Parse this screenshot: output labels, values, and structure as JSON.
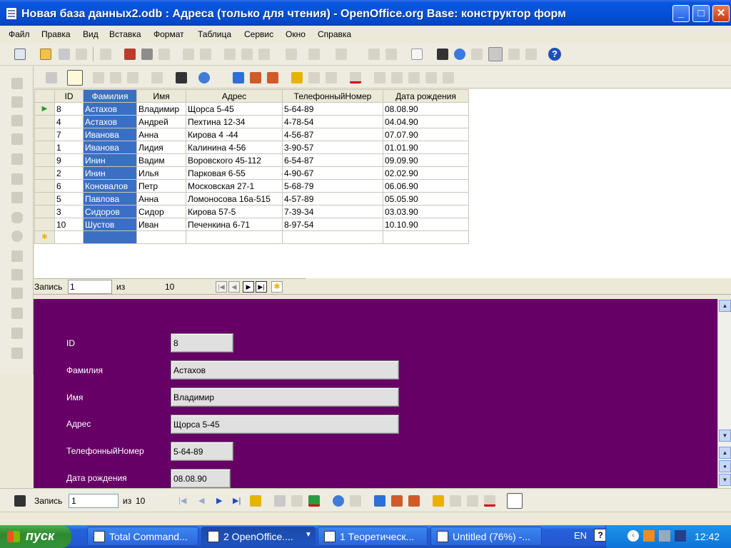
{
  "window": {
    "title": "Новая база данных2.odb : Адреса (только для чтения) - OpenOffice.org Base: конструктор форм",
    "minimize": "_",
    "maximize": "□",
    "close": "✕"
  },
  "menu": [
    "Файл",
    "Правка",
    "Вид",
    "Вставка",
    "Формат",
    "Таблица",
    "Сервис",
    "Окно",
    "Справка"
  ],
  "grid": {
    "columns": [
      "ID",
      "Фамилия",
      "Имя",
      "Адрес",
      "ТелефонныйНомер",
      "Дата рождения"
    ],
    "rows": [
      [
        "8",
        "Астахов",
        "Владимир",
        "Щорса 5-45",
        "5-64-89",
        "08.08.90"
      ],
      [
        "4",
        "Астахов",
        "Андрей",
        "Пехтина 12-34",
        "4-78-54",
        "04.04.90"
      ],
      [
        "7",
        "Иванова",
        "Анна",
        "Кирова 4 -44",
        "4-56-87",
        "07.07.90"
      ],
      [
        "1",
        "Иванова",
        "Лидия",
        "Калинина 4-56",
        "3-90-57",
        "01.01.90"
      ],
      [
        "9",
        "Инин",
        "Вадим",
        "Воровского 45-112",
        "6-54-87",
        "09.09.90"
      ],
      [
        "2",
        "Инин",
        "Илья",
        "Парковая 6-55",
        "4-90-67",
        "02.02.90"
      ],
      [
        "6",
        "Коновалов",
        "Петр",
        "Московская 27-1",
        "5-68-79",
        "06.06.90"
      ],
      [
        "5",
        "Павлова",
        "Анна",
        "Ломоносова 16а-515",
        "4-57-89",
        "05.05.90"
      ],
      [
        "3",
        "Сидоров",
        "Сидор",
        "Кирова 57-5",
        "7-39-34",
        "03.03.90"
      ],
      [
        "10",
        "Шустов",
        "Иван",
        "Печенкина 6-71",
        "8-97-54",
        "10.10.90"
      ]
    ],
    "current_row_marker": "▶",
    "new_row_marker": "✱"
  },
  "grid_nav": {
    "record_label": "Запись",
    "record_value": "1",
    "of_label": "из",
    "total": "10"
  },
  "form": {
    "fields": [
      {
        "label": "ID",
        "value": "8"
      },
      {
        "label": "Фамилия",
        "value": "Астахов"
      },
      {
        "label": "Имя",
        "value": "Владимир"
      },
      {
        "label": "Адрес",
        "value": "Щорса 5-45"
      },
      {
        "label": "ТелефонныйНомер",
        "value": "5-64-89"
      },
      {
        "label": "Дата рождения",
        "value": "08.08.90"
      }
    ]
  },
  "form_nav": {
    "record_label": "Запись",
    "record_value": "1",
    "of_label": "из",
    "total": "10"
  },
  "taskbar": {
    "start": "пуск",
    "tasks": [
      "Total Command...",
      "2 OpenOffice....",
      "1 Теоретическ...",
      "Untitled (76%) -..."
    ],
    "lang": "EN",
    "clock": "12:42"
  },
  "colors": {
    "form_background": "#660066",
    "selection": "#3b6fc3",
    "titlebar": "#0452D8"
  }
}
